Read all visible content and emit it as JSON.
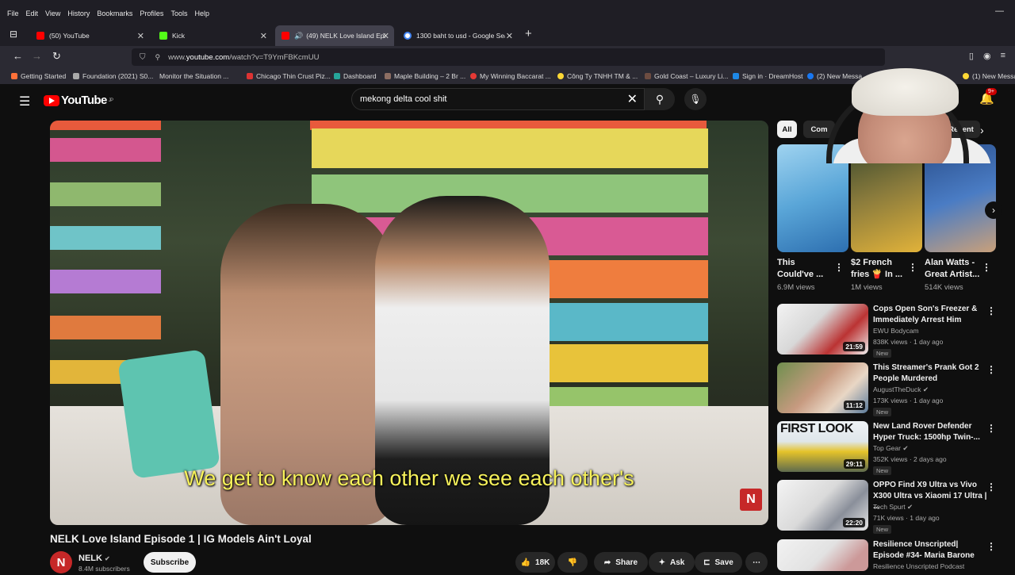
{
  "browser": {
    "menu": [
      "File",
      "Edit",
      "View",
      "History",
      "Bookmarks",
      "Profiles",
      "Tools",
      "Help"
    ],
    "tabs": [
      {
        "label": "(50) YouTube"
      },
      {
        "label": "Kick"
      },
      {
        "label": "(49) NELK Love Island Episo"
      },
      {
        "label": "1300 baht to usd - Google Sear"
      }
    ],
    "url_prefix": "www.",
    "url_host": "youtube.com",
    "url_path": "/watch?v=T9YmFBKcmUU",
    "bookmarks": [
      "Getting Started",
      "Foundation (2021) S0...",
      "Monitor the Situation ...",
      "Chicago Thin Crust Piz...",
      "Dashboard",
      "Maple Building – 2 Br ...",
      "My Winning Baccarat ...",
      "Công Ty TNHH TM & ...",
      "Gold Coast – Luxury Li...",
      "Sign in · DreamHost",
      "(2) New Messa",
      "(1) New Messa"
    ]
  },
  "youtube": {
    "logo": "YouTube",
    "region": "JP",
    "search_value": "mekong delta cool shit",
    "create_label": "reate",
    "notif_count": "9+"
  },
  "video": {
    "subtitle": "We get to know each other we see each other's",
    "watermark": "N",
    "title": "NELK Love Island Episode 1 | IG Models Ain't Loyal",
    "channel": "NELK",
    "subscribers": "8.4M subscribers",
    "subscribe_label": "Subscribe",
    "likes": "18K",
    "share_label": "Share",
    "ask_label": "Ask",
    "save_label": "Save"
  },
  "sidebar": {
    "chips": [
      "All",
      "Com",
      "Recent"
    ],
    "shorts": [
      {
        "title": "This Could've ...",
        "views": "6.9M views"
      },
      {
        "title": "$2 French fries 🍟 In ...",
        "views": "1M views"
      },
      {
        "title": "Alan Watts - Great Artist...",
        "views": "514K views"
      }
    ],
    "recommendations": [
      {
        "title": "Cops Open Son's Freezer & Immediately Arrest Him",
        "channel": "EWU Bodycam",
        "meta": "838K views · 1 day ago",
        "duration": "21:59",
        "badge": "New"
      },
      {
        "title": "This Streamer's Prank Got 2 People Murdered",
        "channel": "AugustTheDuck",
        "meta": "173K views · 1 day ago",
        "duration": "11:12",
        "badge": "New"
      },
      {
        "title": "New Land Rover Defender Hyper Truck: 1500hp Twin-...",
        "channel": "Top Gear",
        "meta": "352K views · 2 days ago",
        "duration": "29:11",
        "badge": "New",
        "thumb_text": "FIRST LOOK"
      },
      {
        "title": "OPPO Find X9 Ultra vs Vivo X300 Ultra vs Xiaomi 17 Ultra | ...",
        "channel": "Tech Spurt",
        "meta": "71K views · 1 day ago",
        "duration": "22:20",
        "badge": "New"
      },
      {
        "title": "Resilience Unscripted| Episode #34- Maria Barone",
        "channel": "Resilience Unscripted Podcast",
        "meta": "",
        "duration": "",
        "badge": ""
      }
    ]
  },
  "colors": {
    "accent": "#ff0000",
    "background": "#0f0f0f",
    "subtitle": "#f7f25a"
  }
}
